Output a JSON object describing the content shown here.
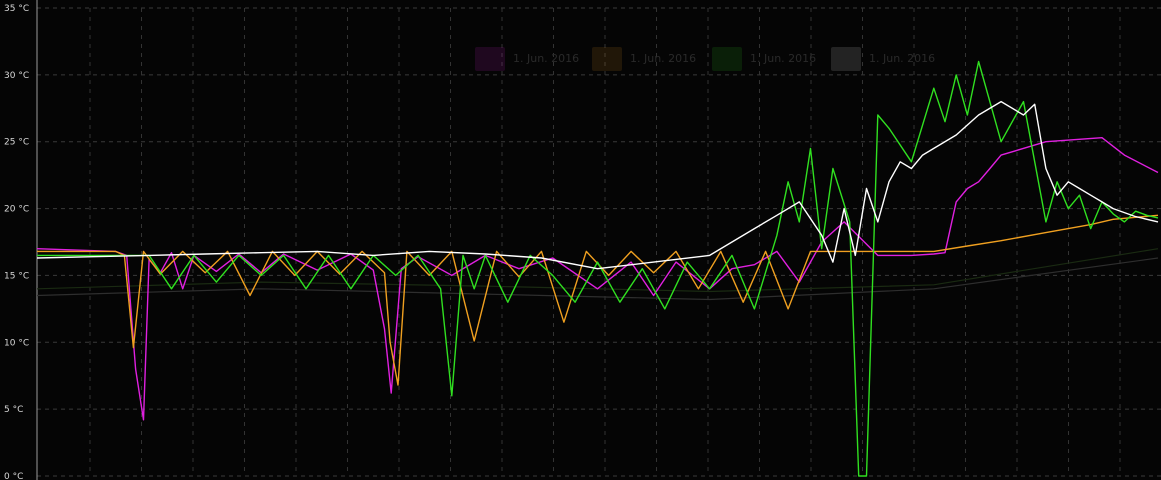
{
  "chart_data": {
    "type": "line",
    "title": "",
    "xlabel": "",
    "ylabel": "",
    "ylim": [
      0,
      35
    ],
    "y_ticks": [
      {
        "value": 35,
        "label": "35 °C"
      },
      {
        "value": 30,
        "label": "30 °C"
      },
      {
        "value": 25,
        "label": "25 °C"
      },
      {
        "value": 20,
        "label": "20 °C"
      },
      {
        "value": 15,
        "label": "15 °C"
      },
      {
        "value": 10,
        "label": "10 °C"
      },
      {
        "value": 5,
        "label": "5 °C"
      },
      {
        "value": 0,
        "label": "0 °C"
      }
    ],
    "grid": true,
    "legend_position": "top-center",
    "legend": [
      {
        "label": "1. Jun. 2016",
        "color": "#e020e0"
      },
      {
        "label": "1. Jun. 2016",
        "color": "#f0a020"
      },
      {
        "label": "1. Jun. 2016",
        "color": "#30e020"
      },
      {
        "label": "1. Jun. 2016",
        "color": "#ffffff"
      }
    ],
    "x_range": [
      0,
      100
    ],
    "series": [
      {
        "color": "#e020e0",
        "x": [
          0,
          7,
          8,
          8.8,
          9.5,
          10,
          11,
          12,
          13,
          14,
          16,
          18,
          20,
          22,
          25,
          28,
          30,
          31,
          31.6,
          32.5,
          34,
          37,
          40,
          43,
          46,
          50,
          53,
          55,
          57,
          60,
          62,
          64,
          66,
          68,
          70,
          72,
          75,
          78,
          80,
          81,
          82,
          83,
          84,
          85,
          86,
          90,
          95,
          97,
          100
        ],
        "y": [
          17,
          16.8,
          16.5,
          8,
          4.2,
          16.2,
          15.2,
          16.7,
          14,
          16.5,
          15.3,
          16.6,
          15.2,
          16.6,
          15.4,
          16.6,
          15.4,
          11,
          6.2,
          15.5,
          16.4,
          15,
          16.5,
          15.5,
          16.3,
          14,
          16,
          13.5,
          16,
          14,
          15.5,
          15.8,
          16.8,
          14.5,
          17.5,
          19,
          16.5,
          16.5,
          16.6,
          16.7,
          20.5,
          21.5,
          22,
          23,
          24,
          25,
          25.3,
          24,
          22.7
        ]
      },
      {
        "color": "#f0a020",
        "x": [
          0,
          7,
          7.8,
          8.6,
          9.5,
          11,
          13,
          15,
          17,
          19,
          21,
          23,
          25,
          27,
          29,
          31,
          31.5,
          32.2,
          33,
          35,
          37,
          39,
          41,
          43,
          45,
          47,
          49,
          51,
          53,
          55,
          57,
          59,
          61,
          63,
          65,
          67,
          69,
          71,
          73,
          76,
          80,
          83,
          86,
          90,
          94,
          96,
          100
        ],
        "y": [
          16.8,
          16.8,
          16.5,
          9.6,
          16.8,
          15.1,
          16.8,
          15.2,
          16.8,
          13.5,
          16.8,
          15,
          16.8,
          15.1,
          16.8,
          15.2,
          10,
          6.8,
          16.8,
          15,
          16.8,
          10.1,
          16.8,
          14.9,
          16.8,
          11.5,
          16.8,
          15,
          16.8,
          15.2,
          16.8,
          14,
          16.8,
          13,
          16.8,
          12.5,
          16.8,
          16.8,
          16.8,
          16.8,
          16.8,
          17.2,
          17.6,
          18.2,
          18.8,
          19.2,
          19.5
        ]
      },
      {
        "color": "#30e020",
        "x": [
          0,
          10,
          12,
          14,
          16,
          18,
          20,
          22,
          24,
          26,
          28,
          30,
          32,
          34,
          36,
          37,
          38,
          39,
          40,
          42,
          44,
          46,
          48,
          50,
          52,
          54,
          56,
          58,
          60,
          62,
          64,
          66,
          67,
          68,
          69,
          70,
          71,
          72.5,
          73.3,
          74,
          75,
          76,
          78,
          80,
          81,
          82,
          83,
          84,
          86,
          88,
          90,
          91,
          92,
          93,
          94,
          95,
          96,
          97,
          98,
          99,
          100
        ],
        "y": [
          16.5,
          16.5,
          14,
          16.5,
          14.5,
          16.5,
          15,
          16.5,
          14,
          16.5,
          14,
          16.5,
          15,
          16.5,
          14,
          6,
          16.5,
          14,
          16.5,
          13,
          16.5,
          15,
          13,
          16,
          13,
          15.5,
          12.5,
          16,
          14,
          16.5,
          12.5,
          18,
          22,
          19,
          24.5,
          17,
          23,
          19,
          0,
          0,
          27,
          26,
          23.5,
          29,
          26.5,
          30,
          27,
          31,
          25,
          28,
          19,
          22,
          20,
          21,
          18.5,
          20.5,
          19.6,
          19,
          19.8,
          19.5,
          19.3
        ]
      },
      {
        "color": "#ffffff",
        "x": [
          0,
          5,
          10,
          15,
          20,
          25,
          30,
          35,
          40,
          45,
          50,
          55,
          60,
          62,
          64,
          66,
          68,
          70,
          71,
          72,
          73,
          74,
          75,
          76,
          77,
          78,
          79,
          80,
          82,
          84,
          86,
          88,
          89,
          90,
          91,
          92,
          93,
          94,
          95,
          96,
          97,
          98,
          100
        ],
        "y": [
          16.3,
          16.4,
          16.5,
          16.6,
          16.7,
          16.8,
          16.5,
          16.8,
          16.6,
          16.3,
          15.5,
          16,
          16.5,
          17.5,
          18.5,
          19.5,
          20.5,
          18,
          16,
          20,
          16.5,
          21.5,
          19,
          22,
          23.5,
          23,
          24,
          24.5,
          25.5,
          27,
          28,
          27,
          27.8,
          23,
          21,
          22,
          21.5,
          21,
          20.5,
          20,
          19.7,
          19.4,
          19.0
        ]
      }
    ],
    "faint_series": [
      {
        "color": "#2e2e2e",
        "x": [
          0,
          20,
          40,
          60,
          80,
          100
        ],
        "y": [
          13.5,
          14,
          13.6,
          13.2,
          14,
          16.3
        ]
      },
      {
        "color": "#1a2a12",
        "x": [
          0,
          20,
          40,
          60,
          80,
          100
        ],
        "y": [
          14,
          14.5,
          14.2,
          13.8,
          14.3,
          17
        ]
      }
    ]
  }
}
